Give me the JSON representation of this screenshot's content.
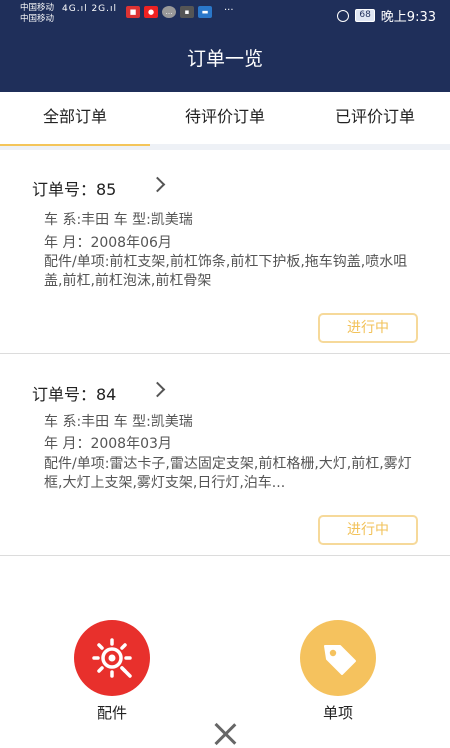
{
  "status_bar": {
    "carrier1": "中国移动",
    "carrier2": "中国移动",
    "network": "4G",
    "network2": "2G",
    "more": "···",
    "battery": "68",
    "time": "晚上9:33"
  },
  "header": {
    "title": "订单一览"
  },
  "tabs": [
    {
      "label": "全部订单",
      "active": true
    },
    {
      "label": "待评价订单",
      "active": false
    },
    {
      "label": "已评价订单",
      "active": false
    }
  ],
  "orders": [
    {
      "order_no": "订单号：85",
      "car": "车 系:丰田 车 型:凯美瑞",
      "date": "年 月：2008年06月",
      "parts": "配件/单项:前杠支架,前杠饰条,前杠下护板,拖车钩盖,喷水咀盖,前杠,前杠泡沫,前杠骨架",
      "status": "进行中"
    },
    {
      "order_no": "订单号：84",
      "car": "车 系:丰田 车 型:凯美瑞",
      "date": "年 月：2008年03月",
      "parts": "配件/单项:雷达卡子,雷达固定支架,前杠格栅,大灯,前杠,雾灯框,大灯上支架,雾灯支架,日行灯,泊车...",
      "status": "进行中"
    }
  ],
  "actions": {
    "parts_label": "配件",
    "item_label": "单项",
    "parts_icon": "wrench-gear-icon",
    "item_icon": "price-tag-icon",
    "parts_color": "#e8302c",
    "item_color": "#f5c25e"
  },
  "colors": {
    "header_bg": "#1f2f5a",
    "accent": "#f4c55a",
    "status_text": "#f2c25a"
  }
}
